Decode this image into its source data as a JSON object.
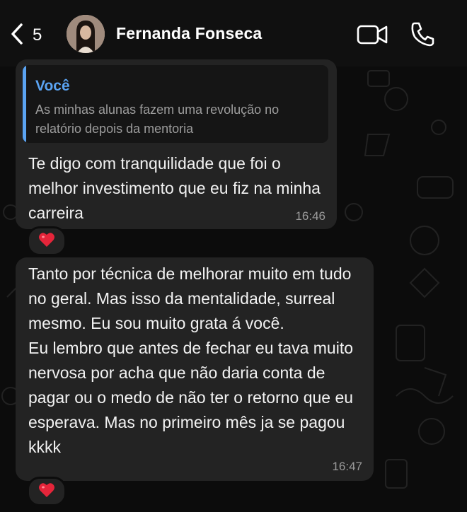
{
  "header": {
    "back_count": "5",
    "contact_name": "Fernanda Fonseca"
  },
  "messages": [
    {
      "quote": {
        "author": "Você",
        "text": "As minhas alunas fazem uma revolução no relatório depois da mentoria"
      },
      "text": "Te digo com tranquilidade que foi o melhor investimento que eu fiz na minha carreira",
      "time": "16:46",
      "reaction": "red-heart"
    },
    {
      "text": "Tanto por técnica de melhorar muito em tudo no geral. Mas isso da mentalidade, surreal mesmo. Eu sou muito grata á você.\nEu lembro que antes de fechar eu tava muito nervosa por acha que não daria conta de pagar ou o medo de não ter o retorno que eu esperava. Mas no primeiro mês ja se pagou kkkk",
      "time": "16:47",
      "reaction": "red-heart"
    }
  ],
  "colors": {
    "quote_accent": "#5aa3f2",
    "bubble": "#232323",
    "reaction_heart": "#e5253a"
  }
}
